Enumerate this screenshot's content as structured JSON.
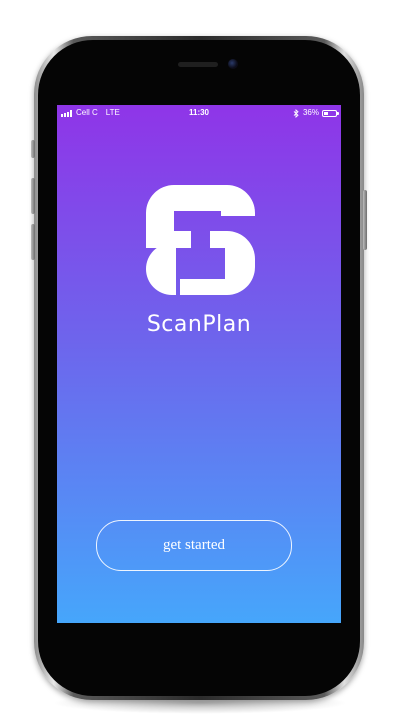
{
  "status_bar": {
    "carrier": "Cell C",
    "network": "LTE",
    "time": "11:30",
    "battery_percent_label": "36%",
    "battery_level": 0.36,
    "signal_bars": 4,
    "bluetooth_icon": "bluetooth-icon"
  },
  "app": {
    "name": "ScanPlan",
    "logo_icon": "scanplan-logo-icon"
  },
  "actions": {
    "get_started_label": "get started"
  },
  "colors": {
    "gradient_top": "#8f35e8",
    "gradient_mid": "#6e64ec",
    "gradient_bottom": "#46a6fb",
    "text": "#ffffff",
    "phone_body": "#050505"
  }
}
